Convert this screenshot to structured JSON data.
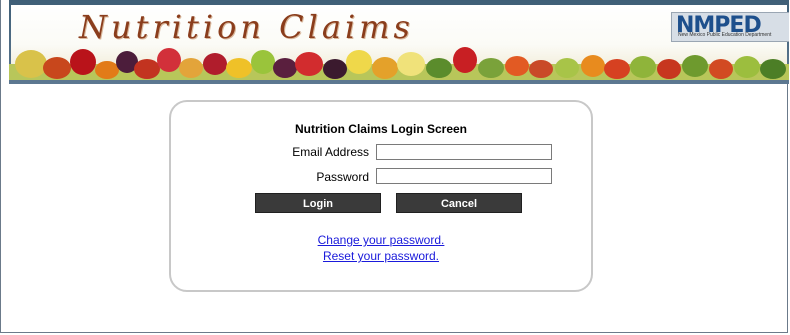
{
  "header": {
    "title": "Nutrition Claims",
    "logo_text": "NMPED",
    "logo_subtext": "New Mexico Public Education Department"
  },
  "login": {
    "title": "Nutrition Claims Login Screen",
    "email_label": "Email Address",
    "email_value": "",
    "password_label": "Password",
    "password_value": "",
    "login_button": "Login",
    "cancel_button": "Cancel",
    "change_password_link": "Change your password.",
    "reset_password_link": "Reset your password."
  },
  "colors": {
    "banner_frame": "#3f5f77",
    "title_text": "#8a3d1c",
    "button": "#3a3a3a",
    "link": "#1a1adb"
  }
}
